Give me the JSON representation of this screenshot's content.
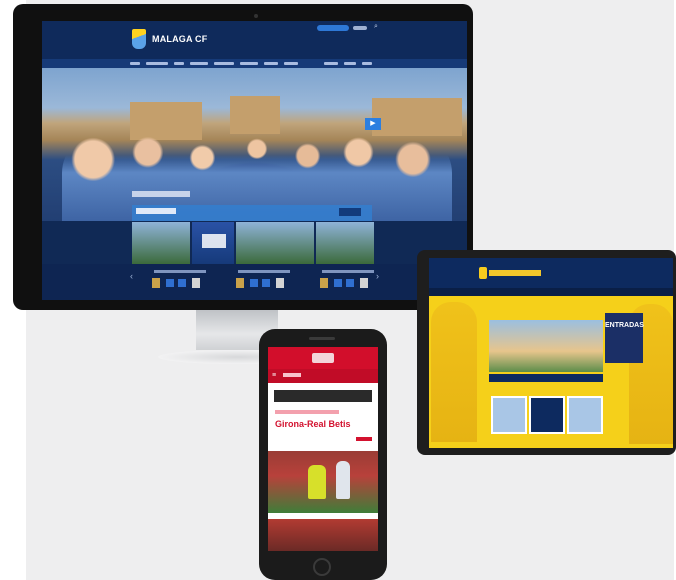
{
  "desktop": {
    "brand_name": "MALAGA CF",
    "brand_colors": {
      "primary": "#0f2a5b",
      "accent": "#2c7fe0",
      "crest_yellow": "#ffd21f"
    },
    "hero_image": "team-celebration-photo",
    "icons": {
      "search": "search-icon",
      "play": "play-icon",
      "prev": "chevron-left-icon",
      "next": "chevron-right-icon"
    },
    "symbols": {
      "search": "⌕",
      "play": "▶",
      "prev": "‹",
      "next": "›"
    }
  },
  "tablet": {
    "brand_colors": {
      "primary": "#0d2a5f",
      "accent": "#f5d01a"
    },
    "promo_label": "ENTRADAS"
  },
  "mobile": {
    "brand_colors": {
      "primary": "#d20e2b"
    },
    "menu_symbol": "≡",
    "headline": "Girona-Real Betis"
  }
}
